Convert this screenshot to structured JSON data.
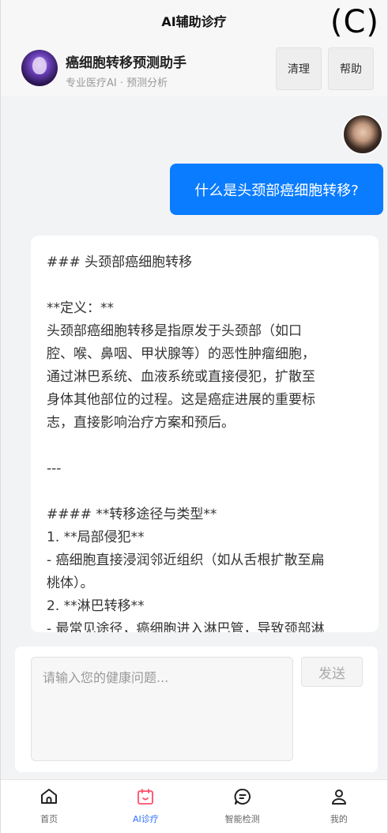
{
  "window": {
    "title": "AI辅助诊疗",
    "corner_label": "(C)"
  },
  "header": {
    "bot_name": "癌细胞转移预测助手",
    "bot_subtitle": "专业医疗AI · 预测分析",
    "clear_label": "清理",
    "help_label": "帮助"
  },
  "chat": {
    "user_message": "什么是头颈部癌细胞转移?",
    "bot_lines": [
      "### 头颈部癌细胞转移",
      "",
      "**定义：**",
      "头颈部癌细胞转移是指原发于头颈部（如口",
      "腔、喉、鼻咽、甲状腺等）的恶性肿瘤细胞，",
      "通过淋巴系统、血液系统或直接侵犯，扩散至",
      "身体其他部位的过程。这是癌症进展的重要标",
      "志，直接影响治疗方案和预后。",
      "",
      "---",
      "",
      "#### **转移途径与类型**",
      "1. **局部侵犯**",
      "- 癌细胞直接浸润邻近组织（如从舌根扩散至扁",
      "桃体）。",
      "2. **淋巴转移**",
      "- 最常见途径，癌细胞进入淋巴管，导致颈部淋"
    ]
  },
  "composer": {
    "placeholder": "请输入您的健康问题...",
    "send_label": "发送"
  },
  "tabs": [
    {
      "label": "首页",
      "icon": "home-icon",
      "active": false
    },
    {
      "label": "AI诊疗",
      "icon": "calendar-smile-icon",
      "active": true
    },
    {
      "label": "智能检测",
      "icon": "chat-lines-icon",
      "active": false
    },
    {
      "label": "我的",
      "icon": "user-icon",
      "active": false
    }
  ],
  "colors": {
    "accent": "#0a7cff",
    "active_tab_icon": "#ff4d6a",
    "active_tab_label": "#2f6fff"
  }
}
